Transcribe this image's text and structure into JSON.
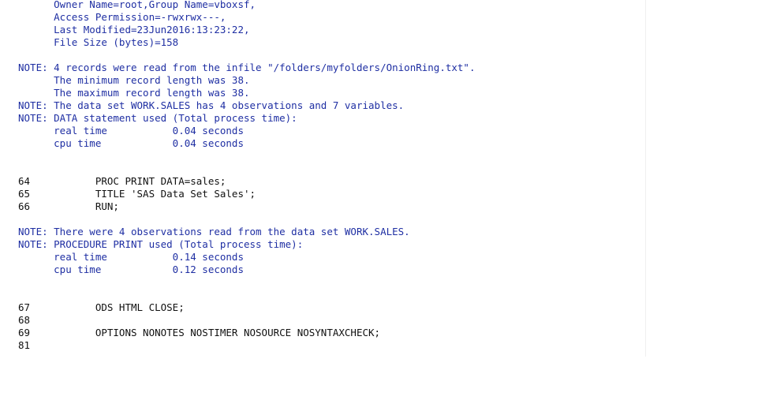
{
  "log_lines": [
    {
      "kind": "note",
      "text": "      Owner Name=root,Group Name=vboxsf,"
    },
    {
      "kind": "note",
      "text": "      Access Permission=-rwxrwx---,"
    },
    {
      "kind": "note",
      "text": "      Last Modified=23Jun2016:13:23:22,"
    },
    {
      "kind": "note",
      "text": "      File Size (bytes)=158"
    },
    {
      "kind": "blank",
      "text": ""
    },
    {
      "kind": "note",
      "text": "NOTE: 4 records were read from the infile \"/folders/myfolders/OnionRing.txt\"."
    },
    {
      "kind": "note",
      "text": "      The minimum record length was 38."
    },
    {
      "kind": "note",
      "text": "      The maximum record length was 38."
    },
    {
      "kind": "note",
      "text": "NOTE: The data set WORK.SALES has 4 observations and 7 variables."
    },
    {
      "kind": "note",
      "text": "NOTE: DATA statement used (Total process time):"
    },
    {
      "kind": "note",
      "text": "      real time           0.04 seconds"
    },
    {
      "kind": "note",
      "text": "      cpu time            0.04 seconds"
    },
    {
      "kind": "blank",
      "text": ""
    },
    {
      "kind": "blank",
      "text": ""
    },
    {
      "kind": "src",
      "text": "64           PROC PRINT DATA=sales;"
    },
    {
      "kind": "src",
      "text": "65           TITLE 'SAS Data Set Sales';"
    },
    {
      "kind": "src",
      "text": "66           RUN;"
    },
    {
      "kind": "blank",
      "text": ""
    },
    {
      "kind": "note",
      "text": "NOTE: There were 4 observations read from the data set WORK.SALES."
    },
    {
      "kind": "note",
      "text": "NOTE: PROCEDURE PRINT used (Total process time):"
    },
    {
      "kind": "note",
      "text": "      real time           0.14 seconds"
    },
    {
      "kind": "note",
      "text": "      cpu time            0.12 seconds"
    },
    {
      "kind": "blank",
      "text": ""
    },
    {
      "kind": "blank",
      "text": ""
    },
    {
      "kind": "src",
      "text": "67           ODS HTML CLOSE;"
    },
    {
      "kind": "src",
      "text": "68"
    },
    {
      "kind": "src",
      "text": "69           OPTIONS NONOTES NOSTIMER NOSOURCE NOSYNTAXCHECK;"
    },
    {
      "kind": "src",
      "text": "81"
    }
  ],
  "colors": {
    "note": "#1f2fa3",
    "source": "#111111",
    "background": "#ffffff"
  }
}
